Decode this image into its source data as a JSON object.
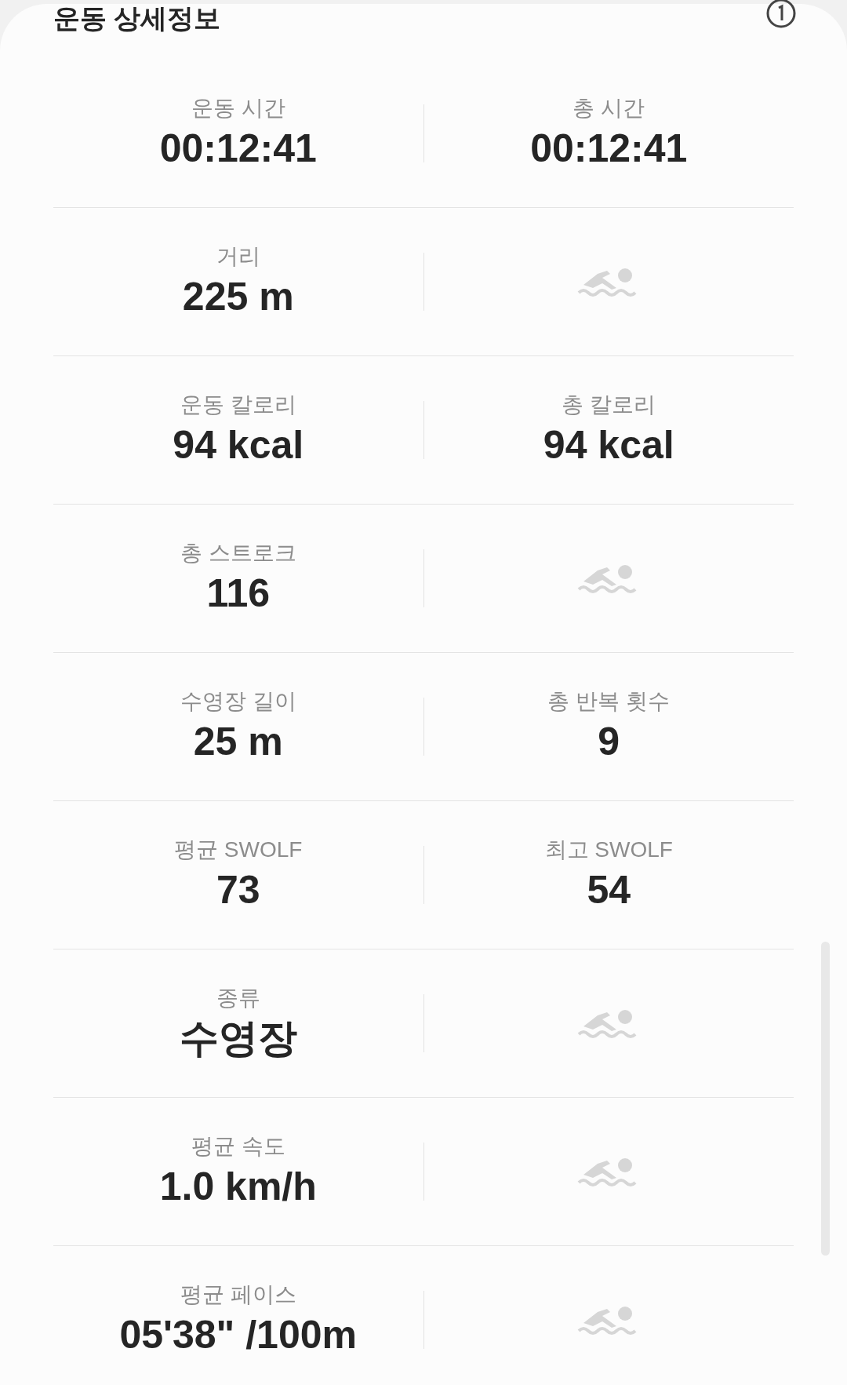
{
  "header": {
    "title": "운동 상세정보"
  },
  "rows": [
    {
      "cells": [
        {
          "kind": "stat",
          "label": "운동 시간",
          "value": "00:12:41"
        },
        {
          "kind": "stat",
          "label": "총 시간",
          "value": "00:12:41"
        }
      ]
    },
    {
      "cells": [
        {
          "kind": "stat",
          "label": "거리",
          "value": "225 m"
        },
        {
          "kind": "icon"
        }
      ]
    },
    {
      "cells": [
        {
          "kind": "stat",
          "label": "운동 칼로리",
          "value": "94 kcal"
        },
        {
          "kind": "stat",
          "label": "총 칼로리",
          "value": "94 kcal"
        }
      ]
    },
    {
      "cells": [
        {
          "kind": "stat",
          "label": "총 스트로크",
          "value": "116"
        },
        {
          "kind": "icon"
        }
      ]
    },
    {
      "cells": [
        {
          "kind": "stat",
          "label": "수영장 길이",
          "value": "25 m"
        },
        {
          "kind": "stat",
          "label": "총 반복 횟수",
          "value": "9"
        }
      ]
    },
    {
      "cells": [
        {
          "kind": "stat",
          "label": "평균 SWOLF",
          "value": "73"
        },
        {
          "kind": "stat",
          "label": "최고 SWOLF",
          "value": "54"
        }
      ]
    },
    {
      "cells": [
        {
          "kind": "stat",
          "label": "종류",
          "value": "수영장"
        },
        {
          "kind": "icon"
        }
      ]
    },
    {
      "cells": [
        {
          "kind": "stat",
          "label": "평균 속도",
          "value": "1.0 km/h"
        },
        {
          "kind": "icon"
        }
      ]
    },
    {
      "cells": [
        {
          "kind": "stat",
          "label": "평균 페이스",
          "value": "05'38\" /100m"
        },
        {
          "kind": "icon"
        }
      ]
    }
  ]
}
